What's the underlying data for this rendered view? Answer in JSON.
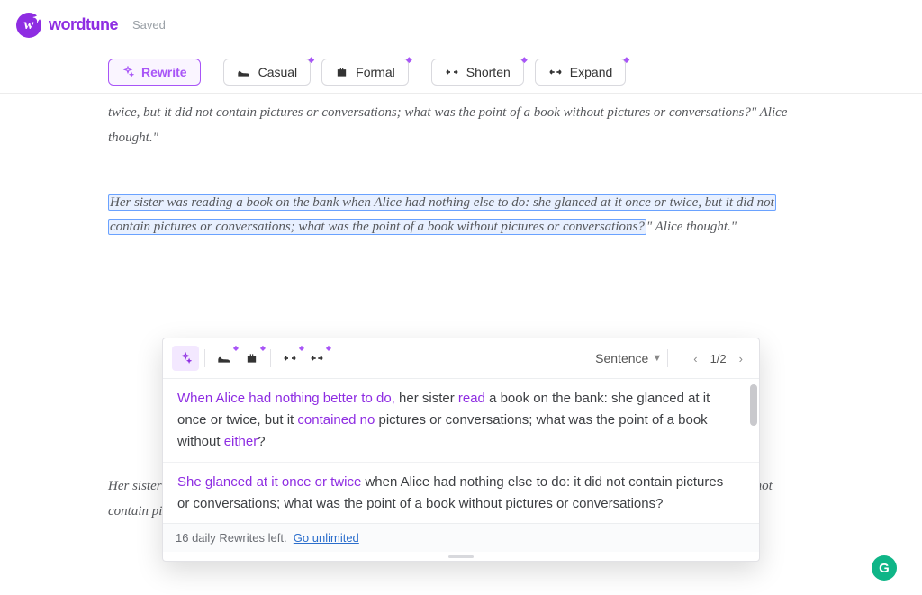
{
  "header": {
    "brand": "wordtune",
    "saved": "Saved"
  },
  "toolbar": {
    "rewrite": "Rewrite",
    "casual": "Casual",
    "formal": "Formal",
    "shorten": "Shorten",
    "expand": "Expand"
  },
  "doc": {
    "para1": "twice, but it did not contain pictures or conversations; what was the point of a book without pictures or conversations?\" Alice thought.\"",
    "para2_hl": "Her sister was reading a book on the bank when Alice had nothing else to do: she glanced at it once or twice, but it did not contain pictures or conversations; what was the point of a book without pictures or conversations?",
    "para2_tail": "\" Alice thought.\"",
    "para3": "Her sister was reading a book on the bank when Alice had nothing else to do: she glanced at it once or twice, but it did not contain pictures or conversations; what was the point of a book without pictures or conversations?\" Alice thought.\""
  },
  "panel": {
    "unit": "Sentence",
    "page": "1/2",
    "suggestions": [
      {
        "segments": [
          {
            "t": "When Alice had nothing better to do,",
            "chg": true
          },
          {
            "t": " her sister ",
            "chg": false
          },
          {
            "t": "read",
            "chg": true
          },
          {
            "t": " a book on the bank: she glanced at it once or twice, but it ",
            "chg": false
          },
          {
            "t": "contained no",
            "chg": true
          },
          {
            "t": " pictures or conversations; what was the point of a book without ",
            "chg": false
          },
          {
            "t": "either",
            "chg": true
          },
          {
            "t": "?",
            "chg": false
          }
        ]
      },
      {
        "segments": [
          {
            "t": "She glanced at it once or twice",
            "chg": true
          },
          {
            "t": " when Alice had nothing else to do: it did not contain pictures or conversations; what was the point of a book without pictures or conversations?",
            "chg": false
          }
        ]
      }
    ],
    "footer_count": "16 daily Rewrites left.",
    "footer_link": "Go unlimited"
  }
}
